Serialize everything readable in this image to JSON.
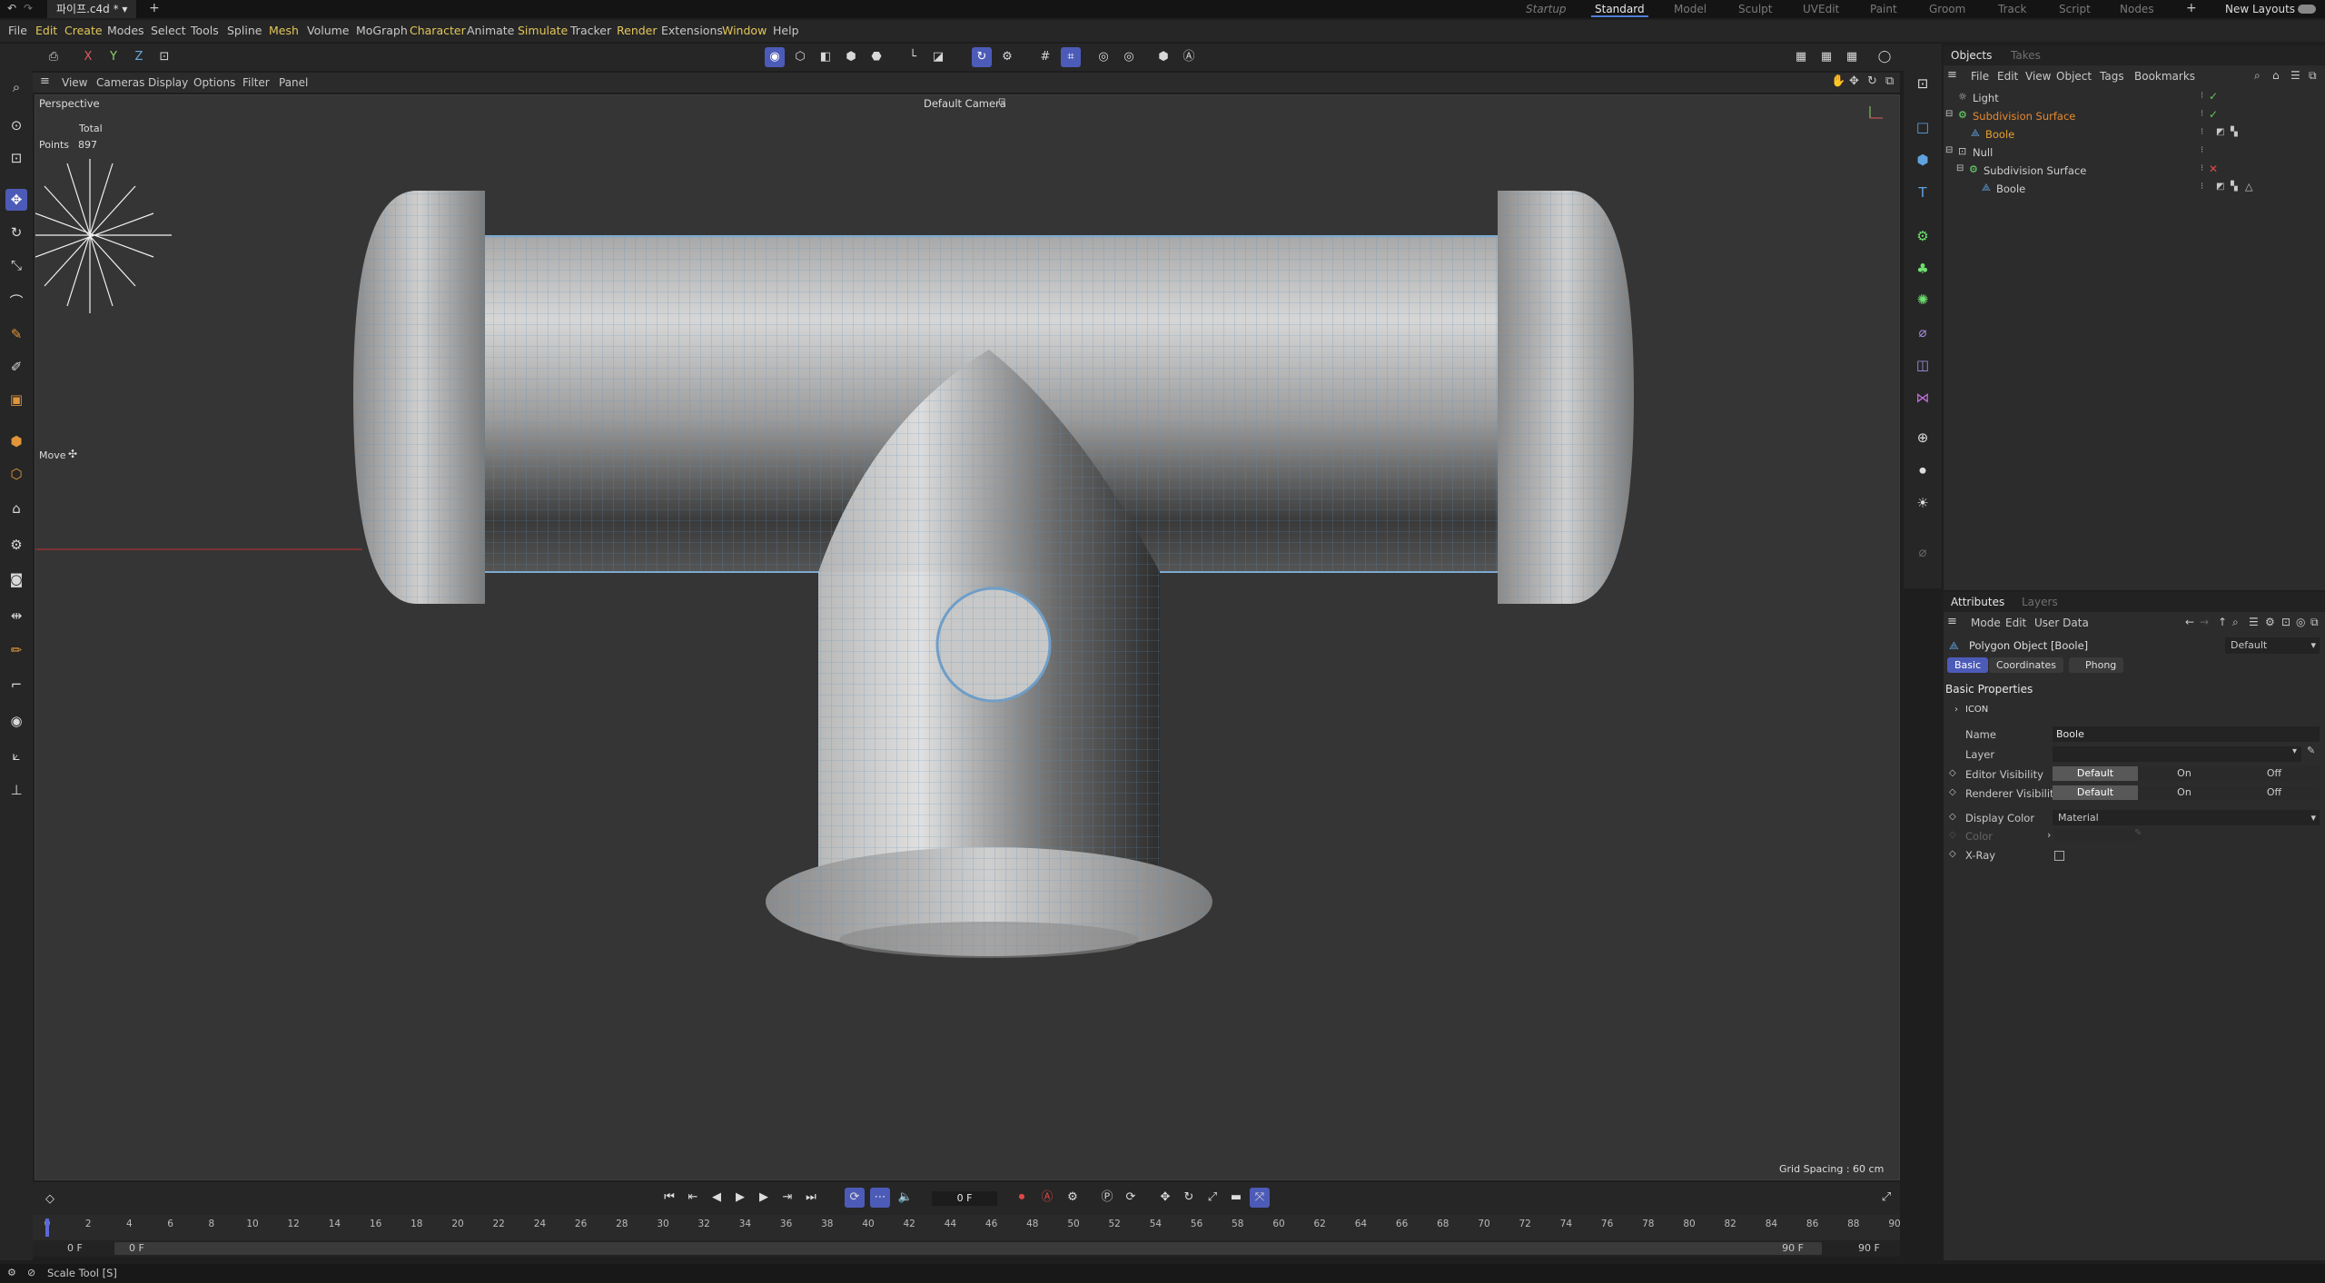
{
  "titlebar": {
    "file_tab": "파이프.c4d *",
    "layouts": [
      "Startup",
      "Standard",
      "Model",
      "Sculpt",
      "UVEdit",
      "Paint",
      "Groom",
      "Track",
      "Script",
      "Nodes"
    ],
    "active_layout": "Standard",
    "new_layouts": "New Layouts"
  },
  "menubar": {
    "items": [
      "File",
      "Edit",
      "Create",
      "Modes",
      "Select",
      "Tools",
      "Spline",
      "Mesh",
      "Volume",
      "MoGraph",
      "Character",
      "Animate",
      "Simulate",
      "Tracker",
      "Render",
      "Extensions",
      "Window",
      "Help"
    ]
  },
  "toolbar": {
    "axis_x": "X",
    "axis_y": "Y",
    "axis_z": "Z"
  },
  "viewport": {
    "menu": [
      "View",
      "Cameras",
      "Display",
      "Options",
      "Filter",
      "Panel"
    ],
    "label": "Perspective",
    "camera": "Default Camera",
    "stats_total": "Total",
    "stats_points_label": "Points",
    "stats_points_value": "897",
    "tool_label": "Move",
    "grid_spacing": "Grid Spacing : 60 cm"
  },
  "objects": {
    "tabs": [
      "Objects",
      "Takes"
    ],
    "menu": [
      "File",
      "Edit",
      "View",
      "Object",
      "Tags",
      "Bookmarks"
    ],
    "rows": [
      {
        "name": "Light",
        "color": "#cfcfcf"
      },
      {
        "name": "Subdivision Surface",
        "color": "#e8892f"
      },
      {
        "name": "Boole",
        "color": "#e8a02f"
      },
      {
        "name": "Null",
        "color": "#cfcfcf"
      },
      {
        "name": "Subdivision Surface",
        "color": "#cfcfcf"
      },
      {
        "name": "Boole",
        "color": "#cfcfcf"
      }
    ]
  },
  "attributes": {
    "tabs": [
      "Attributes",
      "Layers"
    ],
    "menu": [
      "Mode",
      "Edit",
      "User Data"
    ],
    "object_type": "Polygon Object [Boole]",
    "preset": "Default",
    "subtabs": [
      "Basic",
      "Coordinates",
      "Phong"
    ],
    "section": "Basic Properties",
    "icon_group": "ICON",
    "name_label": "Name",
    "name_value": "Boole",
    "layer_label": "Layer",
    "editor_vis_label": "Editor Visibility",
    "render_vis_label": "Renderer Visibility",
    "vis_options": [
      "Default",
      "On",
      "Off"
    ],
    "display_color_label": "Display Color",
    "display_color_value": "Material",
    "color_label": "Color",
    "xray_label": "X-Ray"
  },
  "timeline": {
    "frame": "0 F",
    "ticks": [
      "0",
      "2",
      "4",
      "6",
      "8",
      "10",
      "12",
      "14",
      "16",
      "18",
      "20",
      "22",
      "24",
      "26",
      "28",
      "30",
      "32",
      "34",
      "36",
      "38",
      "40",
      "42",
      "44",
      "46",
      "48",
      "50",
      "52",
      "54",
      "56",
      "58",
      "60",
      "62",
      "64",
      "66",
      "68",
      "70",
      "72",
      "74",
      "76",
      "78",
      "80",
      "82",
      "84",
      "86",
      "88",
      "90"
    ],
    "range_start": "0 F",
    "range_start2": "0 F",
    "range_end": "90 F",
    "range_end2": "90 F"
  },
  "status": {
    "text": "Scale Tool [S]"
  }
}
